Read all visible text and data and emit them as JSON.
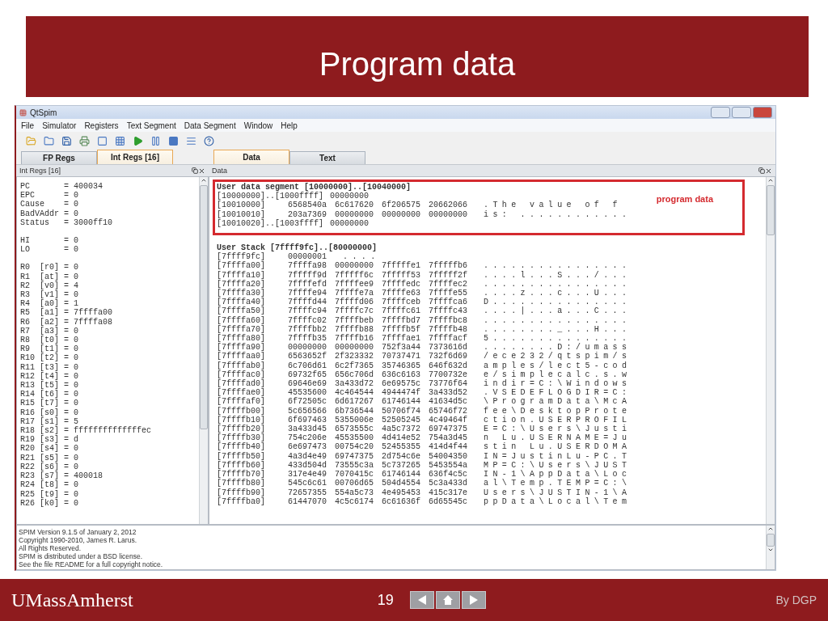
{
  "slide": {
    "title": "Program data",
    "logo": "UMassAmherst",
    "page_number": "19",
    "author": "By DGP"
  },
  "window": {
    "title": "QtSpim"
  },
  "menu": [
    "File",
    "Simulator",
    "Registers",
    "Text Segment",
    "Data Segment",
    "Window",
    "Help"
  ],
  "left_tabs": [
    {
      "label": "FP Regs",
      "selected": false
    },
    {
      "label": "Int Regs [16]",
      "selected": true
    }
  ],
  "left_panel": {
    "title": "Int Regs [16]",
    "register_groups": [
      [
        "PC       = 400034",
        "EPC      = 0",
        "Cause    = 0",
        "BadVAddr = 0",
        "Status   = 3000ff10"
      ],
      [
        "HI       = 0",
        "LO       = 0"
      ],
      [
        "R0  [r0] = 0",
        "R1  [at] = 0",
        "R2  [v0] = 4",
        "R3  [v1] = 0",
        "R4  [a0] = 1",
        "R5  [a1] = 7ffffa00",
        "R6  [a2] = 7ffffa08",
        "R7  [a3] = 0",
        "R8  [t0] = 0",
        "R9  [t1] = 0",
        "R10 [t2] = 0",
        "R11 [t3] = 0",
        "R12 [t4] = 0",
        "R13 [t5] = 0",
        "R14 [t6] = 0",
        "R15 [t7] = 0",
        "R16 [s0] = 0",
        "R17 [s1] = 5",
        "R18 [s2] = ffffffffffffffec",
        "R19 [s3] = d",
        "R20 [s4] = 0",
        "R21 [s5] = 0",
        "R22 [s6] = 0",
        "R23 [s7] = 400018",
        "R24 [t8] = 0",
        "R25 [t9] = 0",
        "R26 [k0] = 0"
      ]
    ]
  },
  "right_tabs": [
    {
      "label": "Data",
      "selected": true
    },
    {
      "label": "Text",
      "selected": false
    }
  ],
  "right_panel": {
    "title": "Data",
    "annotation": "program data",
    "segments": [
      {
        "header": "User data segment [10000000]..[10040000]",
        "highlighted": true,
        "rows": [
          {
            "address": "[10000000]..[1000ffff]",
            "words": [
              "00000000"
            ]
          },
          {
            "address": "[10010000]",
            "words": [
              "6568540a",
              "6c617620",
              "6f206575",
              "20662066"
            ],
            "ascii": ".The value of f"
          },
          {
            "address": "[10010010]",
            "words": [
              "203a7369",
              "00000000",
              "00000000",
              "00000000"
            ],
            "ascii": "is: ............"
          },
          {
            "address": "[10010020]..[1003ffff]",
            "words": [
              "00000000"
            ]
          }
        ]
      },
      {
        "header": "User Stack [7ffff9fc]..[80000000]",
        "highlighted": false,
        "rows": [
          {
            "address": "[7ffff9fc]",
            "words": [
              "00000001"
            ],
            "ascii": "...."
          },
          {
            "address": "[7ffffa00]",
            "words": [
              "7ffffa98",
              "00000000",
              "7fffffe1",
              "7fffffb6"
            ],
            "ascii": "................"
          },
          {
            "address": "[7ffffa10]",
            "words": [
              "7fffff9d",
              "7fffff6c",
              "7fffff53",
              "7fffff2f"
            ],
            "ascii": "....l...S.../..."
          },
          {
            "address": "[7ffffa20]",
            "words": [
              "7ffffefd",
              "7ffffee9",
              "7ffffedc",
              "7ffffec2"
            ],
            "ascii": "................"
          },
          {
            "address": "[7ffffa30]",
            "words": [
              "7ffffe94",
              "7ffffe7a",
              "7ffffe63",
              "7ffffe55"
            ],
            "ascii": "....z...c...U..."
          },
          {
            "address": "[7ffffa40]",
            "words": [
              "7ffffd44",
              "7ffffd06",
              "7ffffceb",
              "7ffffca6"
            ],
            "ascii": "D..............."
          },
          {
            "address": "[7ffffa50]",
            "words": [
              "7ffffc94",
              "7ffffc7c",
              "7ffffc61",
              "7ffffc43"
            ],
            "ascii": "....|...a...C..."
          },
          {
            "address": "[7ffffa60]",
            "words": [
              "7ffffc02",
              "7ffffbeb",
              "7ffffbd7",
              "7ffffbc8"
            ],
            "ascii": "................"
          },
          {
            "address": "[7ffffa70]",
            "words": [
              "7ffffbb2",
              "7ffffb88",
              "7ffffb5f",
              "7ffffb48"
            ],
            "ascii": "........_...H..."
          },
          {
            "address": "[7ffffa80]",
            "words": [
              "7ffffb35",
              "7ffffb16",
              "7ffffae1",
              "7ffffacf"
            ],
            "ascii": "5..............."
          },
          {
            "address": "[7ffffa90]",
            "words": [
              "00000000",
              "00000000",
              "752f3a44",
              "7373616d"
            ],
            "ascii": "........D:/umass"
          },
          {
            "address": "[7ffffaa0]",
            "words": [
              "6563652f",
              "2f323332",
              "70737471",
              "732f6d69"
            ],
            "ascii": "/ece232/qtspim/s"
          },
          {
            "address": "[7ffffab0]",
            "words": [
              "6c706d61",
              "6c2f7365",
              "35746365",
              "646f632d"
            ],
            "ascii": "amples/lect5-cod"
          },
          {
            "address": "[7ffffac0]",
            "words": [
              "69732f65",
              "656c706d",
              "636c6163",
              "7700732e"
            ],
            "ascii": "e/simplecalc.s.w"
          },
          {
            "address": "[7ffffad0]",
            "words": [
              "69646e69",
              "3a433d72",
              "6e69575c",
              "73776f64"
            ],
            "ascii": "indir=C:\\Windows"
          },
          {
            "address": "[7ffffae0]",
            "words": [
              "45535600",
              "4c464544",
              "4944474f",
              "3a433d52"
            ],
            "ascii": ".VSEDEFLOGDIR=C:"
          },
          {
            "address": "[7ffffaf0]",
            "words": [
              "6f72505c",
              "6d617267",
              "61746144",
              "41634d5c"
            ],
            "ascii": "\\ProgramData\\McA"
          },
          {
            "address": "[7ffffb00]",
            "words": [
              "5c656566",
              "6b736544",
              "50706f74",
              "65746f72"
            ],
            "ascii": "fee\\DesktopProte"
          },
          {
            "address": "[7ffffb10]",
            "words": [
              "6f697463",
              "5355006e",
              "52505245",
              "4c49464f"
            ],
            "ascii": "ction.USERPROFIL"
          },
          {
            "address": "[7ffffb20]",
            "words": [
              "3a433d45",
              "6573555c",
              "4a5c7372",
              "69747375"
            ],
            "ascii": "E=C:\\Users\\Justi"
          },
          {
            "address": "[7ffffb30]",
            "words": [
              "754c206e",
              "45535500",
              "4d414e52",
              "754a3d45"
            ],
            "ascii": "n Lu.USERNAME=Ju"
          },
          {
            "address": "[7ffffb40]",
            "words": [
              "6e697473",
              "00754c20",
              "52455355",
              "414d4f44"
            ],
            "ascii": "stin Lu.USERDOMA"
          },
          {
            "address": "[7ffffb50]",
            "words": [
              "4a3d4e49",
              "69747375",
              "2d754c6e",
              "54004350"
            ],
            "ascii": "IN=JustinLu-PC.T"
          },
          {
            "address": "[7ffffb60]",
            "words": [
              "433d504d",
              "73555c3a",
              "5c737265",
              "5453554a"
            ],
            "ascii": "MP=C:\\Users\\JUST"
          },
          {
            "address": "[7ffffb70]",
            "words": [
              "317e4e49",
              "7070415c",
              "61746144",
              "636f4c5c"
            ],
            "ascii": "IN-1\\AppData\\Loc"
          },
          {
            "address": "[7ffffb80]",
            "words": [
              "545c6c61",
              "00706d65",
              "504d4554",
              "5c3a433d"
            ],
            "ascii": "al\\Temp.TEMP=C:\\"
          },
          {
            "address": "[7ffffb90]",
            "words": [
              "72657355",
              "554a5c73",
              "4e495453",
              "415c317e"
            ],
            "ascii": "Users\\JUSTIN-1\\A"
          },
          {
            "address": "[7ffffba0]",
            "words": [
              "61447070",
              "4c5c6174",
              "6c61636f",
              "6d65545c"
            ],
            "ascii": "ppData\\Local\\Tem"
          }
        ]
      }
    ]
  },
  "console": [
    "SPIM Version 9.1.5 of January 2, 2012",
    "Copyright 1990-2010, James R. Larus.",
    "All Rights Reserved.",
    "SPIM is distributed under a BSD license.",
    "See the file README for a full copyright notice."
  ]
}
